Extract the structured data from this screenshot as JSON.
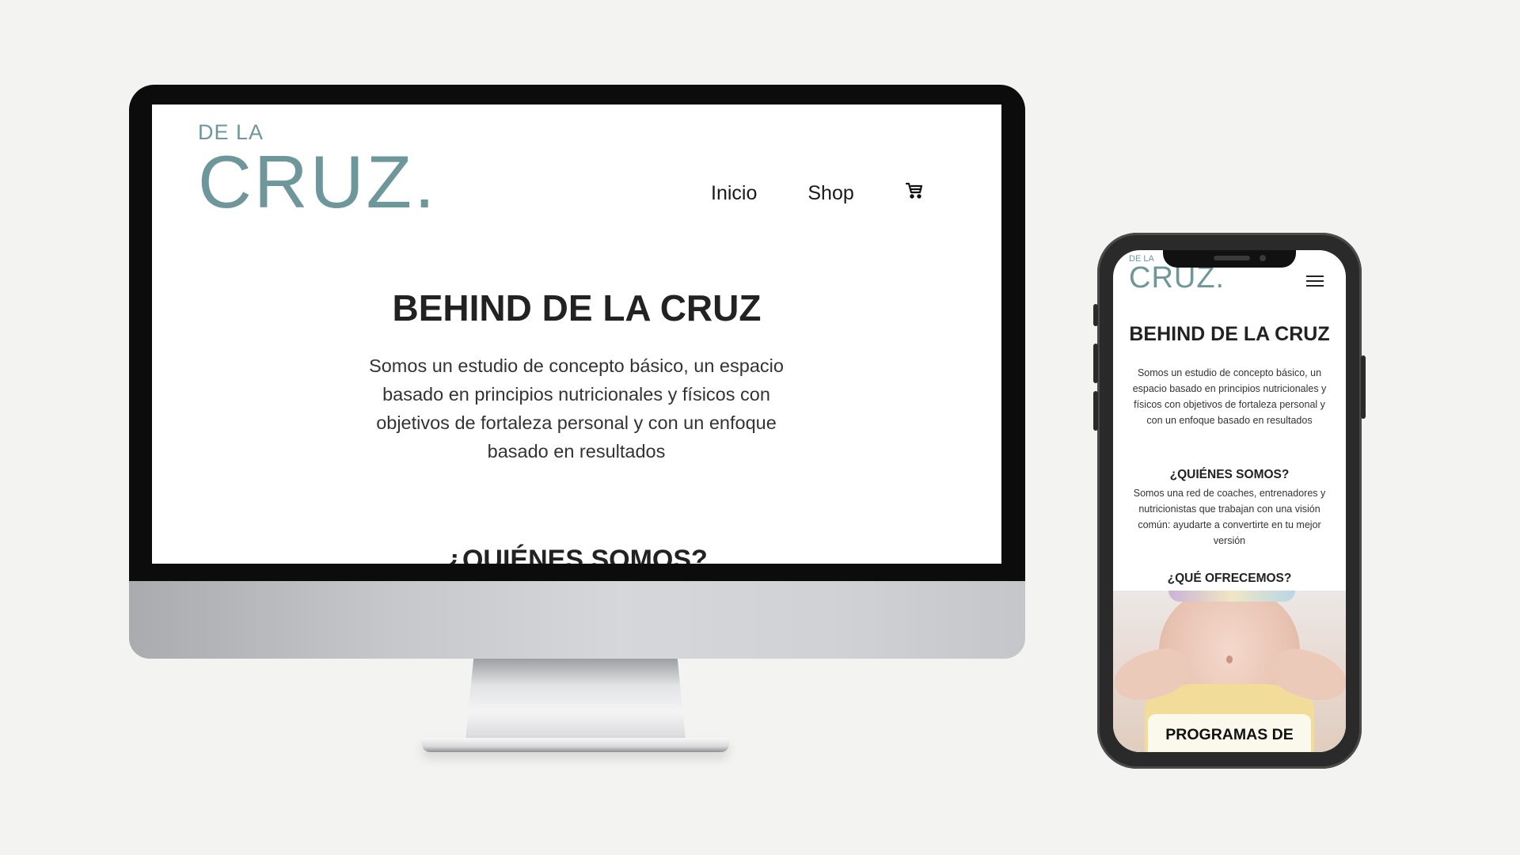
{
  "brand": {
    "logo_top": "DE LA",
    "logo_main": "CRUZ.",
    "color": "#6e979c"
  },
  "desktop": {
    "nav": {
      "home": "Inicio",
      "shop": "Shop",
      "cart_icon": "cart-icon"
    },
    "hero": {
      "title": "BEHIND DE LA CRUZ",
      "description": "Somos un estudio de concepto básico, un espacio basado en principios nutricionales y físicos con objetivos de fortaleza personal y con un enfoque basado en resultados"
    },
    "section_heading": "¿QUIÉNES SOMOS?"
  },
  "mobile": {
    "menu_icon": "hamburger-menu-icon",
    "hero": {
      "title": "BEHIND DE LA CRUZ",
      "description": "Somos un estudio de concepto básico, un espacio basado en principios nutricionales y físicos con objetivos de fortaleza personal y con un enfoque basado en resultados"
    },
    "about": {
      "heading": "¿QUIÉNES SOMOS?",
      "text": "Somos una red de coaches, entrenadores y nutricionistas que trabajan con una visión común: ayudarte a convertirte en tu mejor versión"
    },
    "offer_heading": "¿QUÉ OFRECEMOS?",
    "card_label": "PROGRAMAS DE"
  }
}
